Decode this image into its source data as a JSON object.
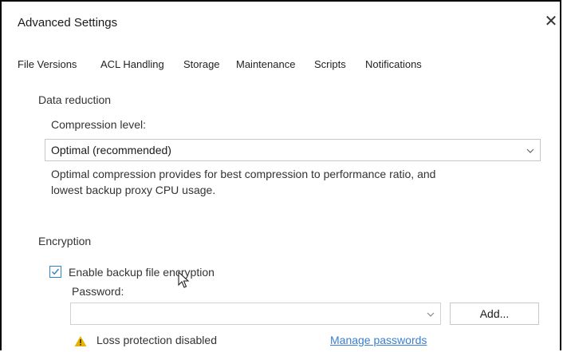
{
  "window": {
    "title": "Advanced Settings",
    "close_icon": "close-icon"
  },
  "tabs": [
    "File Versions",
    "ACL Handling",
    "Storage",
    "Maintenance",
    "Scripts",
    "Notifications"
  ],
  "active_tab": "Storage",
  "data_reduction": {
    "heading": "Data reduction",
    "compression_label": "Compression level:",
    "compression_value": "Optimal (recommended)",
    "description_line1": "Optimal compression provides for best compression to performance ratio, and",
    "description_line2": "lowest backup proxy CPU usage."
  },
  "encryption": {
    "heading": "Encryption",
    "enable_label": "Enable backup file encryption",
    "enabled": true,
    "password_label": "Password:",
    "password_value": "",
    "add_button": "Add...",
    "warning_text": "Loss protection disabled",
    "manage_link": "Manage passwords"
  },
  "colors": {
    "link": "#3a7fd0",
    "checkbox_accent": "#2b86c9",
    "warning": "#e8b400"
  }
}
